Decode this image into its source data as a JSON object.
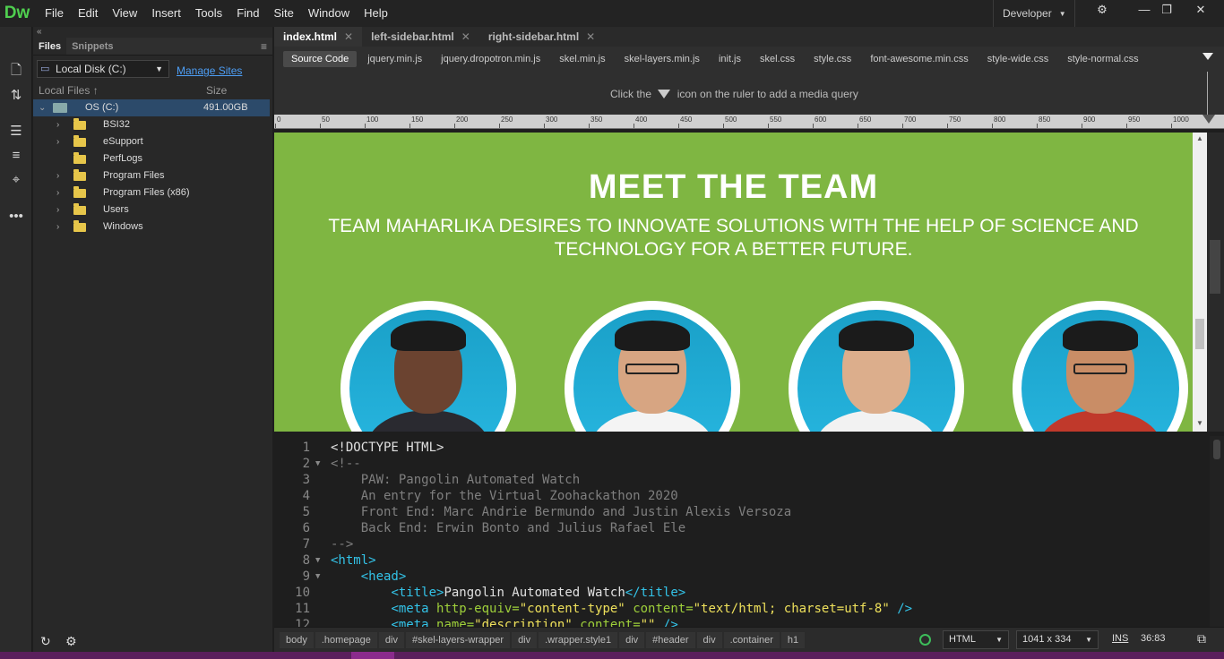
{
  "app": {
    "logo": "Dw"
  },
  "menu": [
    {
      "label": "File",
      "u": "F",
      "rest": "ile"
    },
    {
      "label": "Edit",
      "u": "E",
      "rest": "dit"
    },
    {
      "label": "View",
      "u": "V",
      "rest": "iew"
    },
    {
      "label": "Insert",
      "u": "I",
      "rest": "nsert"
    },
    {
      "label": "Tools",
      "u": "T",
      "rest": "ools"
    },
    {
      "label": "Find",
      "u": "",
      "rest": "Find"
    },
    {
      "label": "Site",
      "u": "S",
      "rest": "ite"
    },
    {
      "label": "Window",
      "u": "W",
      "rest": "indow"
    },
    {
      "label": "Help",
      "u": "H",
      "rest": "elp"
    }
  ],
  "workspace": {
    "label": "Developer"
  },
  "files_panel": {
    "tabs": [
      "Files",
      "Snippets"
    ],
    "site": "Local Disk (C:)",
    "manage_sites": "Manage Sites",
    "col_local": "Local Files",
    "col_size": "Size",
    "root": {
      "name": "OS (C:)",
      "size": "491.00GB"
    },
    "folders": [
      {
        "name": "BSI32",
        "expandable": true
      },
      {
        "name": "eSupport",
        "expandable": true
      },
      {
        "name": "PerfLogs",
        "expandable": false
      },
      {
        "name": "Program Files",
        "expandable": true
      },
      {
        "name": "Program Files (x86)",
        "expandable": true
      },
      {
        "name": "Users",
        "expandable": true
      },
      {
        "name": "Windows",
        "expandable": true
      }
    ]
  },
  "doc_tabs": [
    {
      "label": "index.html",
      "active": true
    },
    {
      "label": "left-sidebar.html",
      "active": false
    },
    {
      "label": "right-sidebar.html",
      "active": false
    }
  ],
  "related_files": [
    "Source Code",
    "jquery.min.js",
    "jquery.dropotron.min.js",
    "skel.min.js",
    "skel-layers.min.js",
    "init.js",
    "skel.css",
    "style.css",
    "font-awesome.min.css",
    "style-wide.css",
    "style-normal.css"
  ],
  "media_query_hint": {
    "before": "Click the",
    "after": "icon on the ruler to add a media query"
  },
  "ruler_ticks": [
    "0",
    "50",
    "100",
    "150",
    "200",
    "250",
    "300",
    "350",
    "400",
    "450",
    "500",
    "550",
    "600",
    "650",
    "700",
    "750",
    "800",
    "850",
    "900",
    "950",
    "1000"
  ],
  "live_view": {
    "heading": "MEET THE TEAM",
    "subheading": "TEAM MAHARLIKA DESIRES TO INNOVATE SOLUTIONS WITH THE HELP OF SCIENCE AND TECHNOLOGY FOR A BETTER FUTURE.",
    "members": [
      {
        "skin": "#6b4330",
        "shirt": "#2a2a30",
        "glasses": false
      },
      {
        "skin": "#d7a582",
        "shirt": "#f4f4f4",
        "glasses": true
      },
      {
        "skin": "#dcae8c",
        "shirt": "#f2f2f2",
        "glasses": false
      },
      {
        "skin": "#c98d66",
        "shirt": "#c0392b",
        "glasses": true
      }
    ]
  },
  "code_lines": [
    {
      "n": "1",
      "fold": "",
      "parts": [
        [
          "t-doc",
          "<!DOCTYPE HTML>"
        ]
      ]
    },
    {
      "n": "2",
      "fold": "▼",
      "parts": [
        [
          "t-com",
          "<!--"
        ]
      ]
    },
    {
      "n": "3",
      "fold": "",
      "parts": [
        [
          "t-com",
          "    PAW: Pangolin Automated Watch"
        ]
      ]
    },
    {
      "n": "4",
      "fold": "",
      "parts": [
        [
          "t-com",
          "    An entry for the Virtual Zoohackathon 2020"
        ]
      ]
    },
    {
      "n": "5",
      "fold": "",
      "parts": [
        [
          "t-com",
          "    Front End: Marc Andrie Bermundo and Justin Alexis Versoza"
        ]
      ]
    },
    {
      "n": "6",
      "fold": "",
      "parts": [
        [
          "t-com",
          "    Back End: Erwin Bonto and Julius Rafael Ele"
        ]
      ]
    },
    {
      "n": "7",
      "fold": "",
      "parts": [
        [
          "t-com",
          "-->"
        ]
      ]
    },
    {
      "n": "8",
      "fold": "▼",
      "parts": [
        [
          "t-tag",
          "<html>"
        ]
      ]
    },
    {
      "n": "9",
      "fold": "▼",
      "parts": [
        [
          "t-txt",
          "    "
        ],
        [
          "t-tag",
          "<head>"
        ]
      ]
    },
    {
      "n": "10",
      "fold": "",
      "parts": [
        [
          "t-txt",
          "        "
        ],
        [
          "t-tag",
          "<title>"
        ],
        [
          "t-txt",
          "Pangolin Automated Watch"
        ],
        [
          "t-tag",
          "</title>"
        ]
      ]
    },
    {
      "n": "11",
      "fold": "",
      "parts": [
        [
          "t-txt",
          "        "
        ],
        [
          "t-tag",
          "<meta "
        ],
        [
          "t-attr",
          "http-equiv="
        ],
        [
          "t-str",
          "\"content-type\""
        ],
        [
          "t-txt",
          " "
        ],
        [
          "t-attr",
          "content="
        ],
        [
          "t-str",
          "\"text/html; charset=utf-8\""
        ],
        [
          "t-tag",
          " />"
        ]
      ]
    },
    {
      "n": "12",
      "fold": "",
      "parts": [
        [
          "t-txt",
          "        "
        ],
        [
          "t-tag",
          "<meta "
        ],
        [
          "t-attr",
          "name="
        ],
        [
          "t-str",
          "\"description\""
        ],
        [
          "t-txt",
          " "
        ],
        [
          "t-attr",
          "content="
        ],
        [
          "t-str",
          "\"\""
        ],
        [
          "t-tag",
          " />"
        ]
      ]
    }
  ],
  "breadcrumbs": [
    "body",
    ".homepage",
    "div",
    "#skel-layers-wrapper",
    "div",
    ".wrapper.style1",
    "div",
    "#header",
    "div",
    ".container",
    "h1"
  ],
  "status": {
    "doc_type": "HTML",
    "window_size": "1041 x 334",
    "mode": "INS",
    "cursor": "36:83"
  }
}
